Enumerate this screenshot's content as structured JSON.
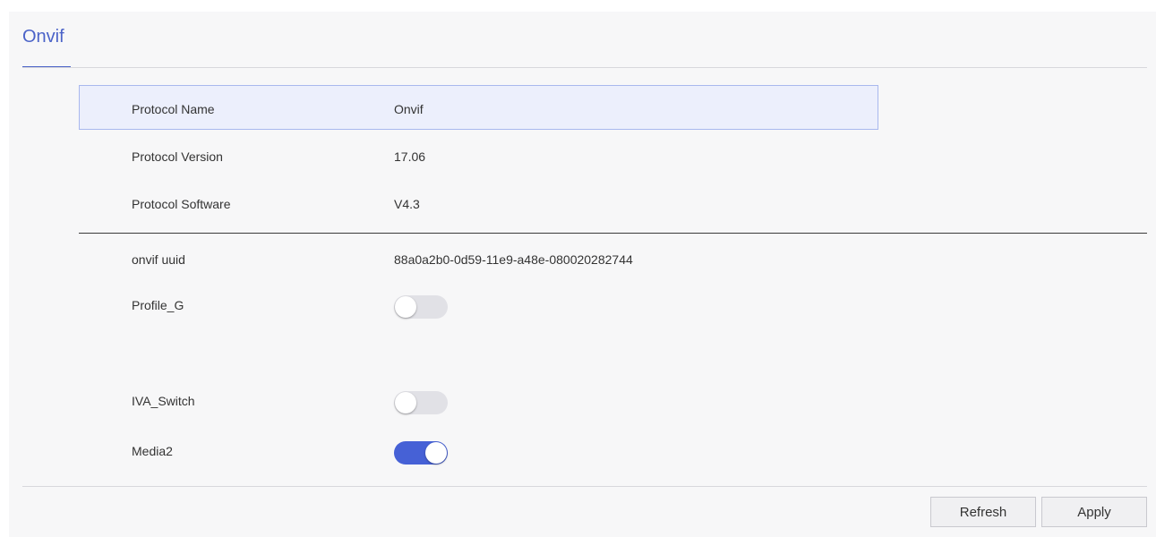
{
  "tab": {
    "title": "Onvif"
  },
  "info": {
    "protocol_name_label": "Protocol Name",
    "protocol_name_value": "Onvif",
    "protocol_version_label": "Protocol Version",
    "protocol_version_value": "17.06",
    "protocol_software_label": "Protocol Software",
    "protocol_software_value": "V4.3",
    "uuid_label": "onvif uuid",
    "uuid_value": "88a0a2b0-0d59-11e9-a48e-080020282744"
  },
  "switches": {
    "profile_g": {
      "label": "Profile_G",
      "state": "off"
    },
    "iva_switch": {
      "label": "IVA_Switch",
      "state": "off"
    },
    "media2": {
      "label": "Media2",
      "state": "on"
    }
  },
  "buttons": {
    "refresh": "Refresh",
    "apply": "Apply"
  },
  "colors": {
    "accent": "#4661d6",
    "tab_text": "#4b63c8",
    "highlight_bg": "#eceffc",
    "highlight_border": "#a9b8ee",
    "panel_bg": "#f7f7f8"
  }
}
